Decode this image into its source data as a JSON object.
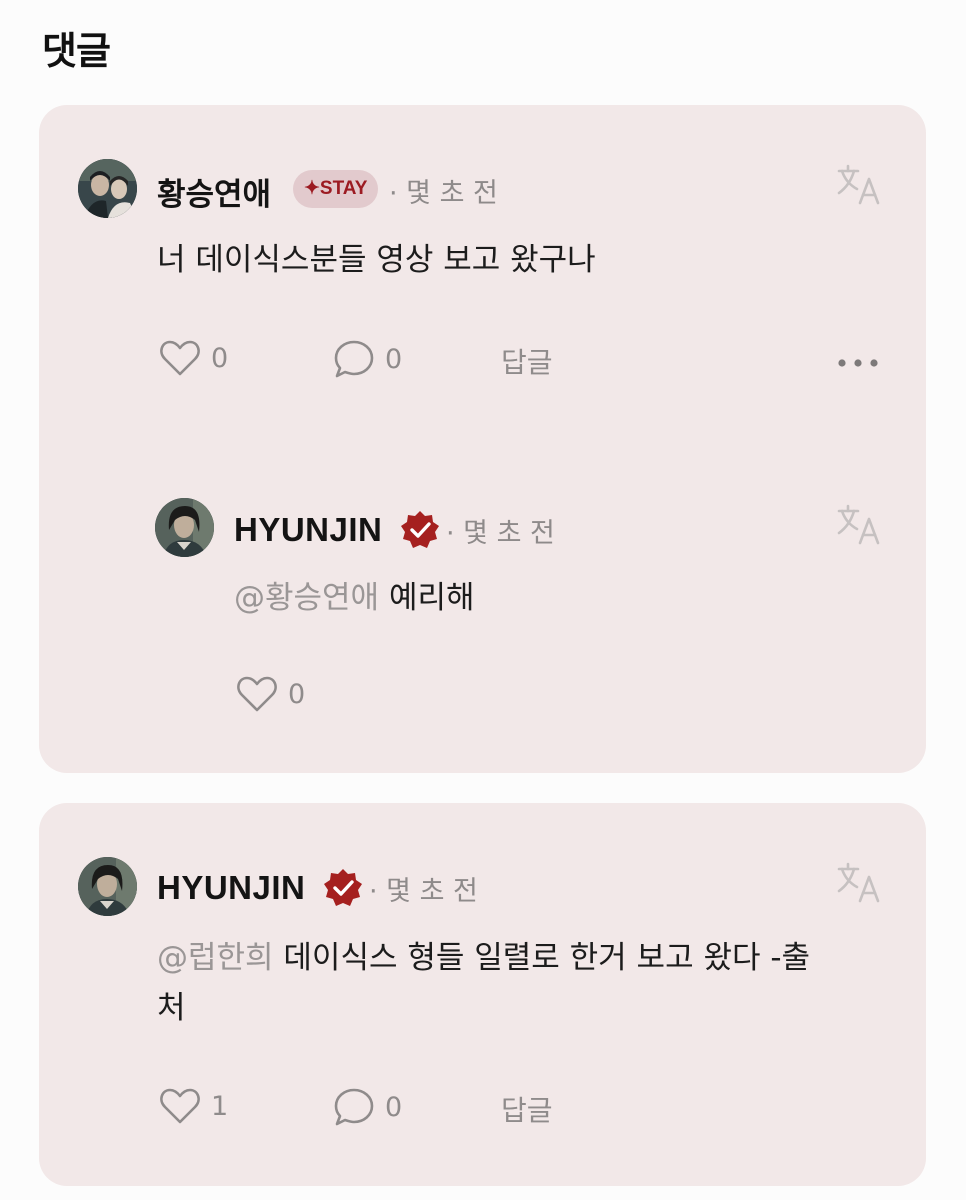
{
  "section": {
    "title": "댓글"
  },
  "comments": [
    {
      "author": "황승연애",
      "badge": "✦STAY",
      "time": "· 몇 초 전",
      "text": "너 데이식스분들 영상 보고 왔구나",
      "likes": "0",
      "replies": "0",
      "reply_label": "답글",
      "reply": {
        "author": "HYUNJIN",
        "time": "· 몇 초 전",
        "mention": "@황승연애",
        "text": " 예리해",
        "likes": "0"
      }
    },
    {
      "author": "HYUNJIN",
      "time": "· 몇 초 전",
      "mention": "@럽한희",
      "text": " 데이식스 형들 일렬로 한거 보고 왔다 -출",
      "text_line2": "처",
      "likes": "1",
      "replies": "0",
      "reply_label": "답글"
    }
  ],
  "colors": {
    "card_bg": "#f2e8e8",
    "badge_bg": "#e2cacd",
    "badge_text": "#9c1b22",
    "verified": "#a5201f",
    "muted": "#8f8b8b"
  },
  "icons": [
    "heart-icon",
    "comment-bubble-icon",
    "translate-icon",
    "more-dots-icon",
    "verified-badge-icon"
  ]
}
